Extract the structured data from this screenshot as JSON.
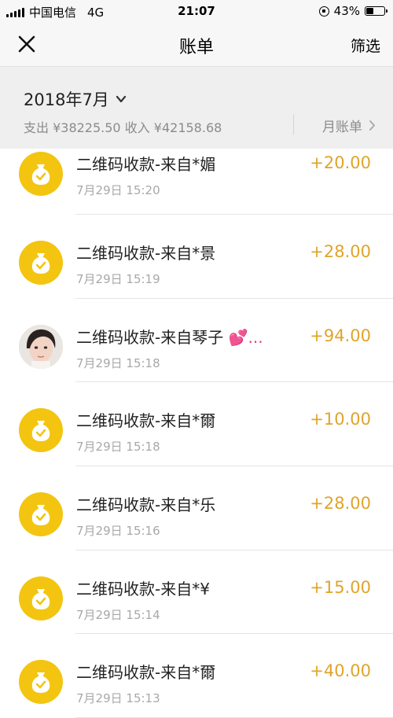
{
  "status_bar": {
    "carrier": "中国电信",
    "network": "4G",
    "time": "21:07",
    "battery": "43%",
    "battery_level": 0.43
  },
  "nav": {
    "title": "账单",
    "filter_label": "筛选",
    "close_icon": "close-icon"
  },
  "summary": {
    "month": "2018年7月",
    "totals": "支出 ¥38225.50 收入 ¥42158.68",
    "monthly_bill_label": "月账单"
  },
  "colors": {
    "amount": "#e0a42a",
    "pay_icon_bg": "#f3c510"
  },
  "transactions": [
    {
      "title": "二维码收款-来自*媚",
      "time": "7月29日 15:20",
      "amount": "+20.00",
      "icon": "money-bag-icon"
    },
    {
      "title": "二维码收款-来自*景",
      "time": "7月29日 15:19",
      "amount": "+28.00",
      "icon": "money-bag-icon"
    },
    {
      "title": "二维码收款-来自琴子",
      "title_suffix": "💕...",
      "time": "7月29日 15:18",
      "amount": "+94.00",
      "icon": "user-avatar-photo"
    },
    {
      "title": "二维码收款-来自*爾",
      "time": "7月29日 15:18",
      "amount": "+10.00",
      "icon": "money-bag-icon"
    },
    {
      "title": "二维码收款-来自*乐",
      "time": "7月29日 15:16",
      "amount": "+28.00",
      "icon": "money-bag-icon"
    },
    {
      "title": "二维码收款-来自*¥",
      "time": "7月29日 15:14",
      "amount": "+15.00",
      "icon": "money-bag-icon"
    },
    {
      "title": "二维码收款-来自*爾",
      "time": "7月29日 15:13",
      "amount": "+40.00",
      "icon": "money-bag-icon"
    }
  ]
}
